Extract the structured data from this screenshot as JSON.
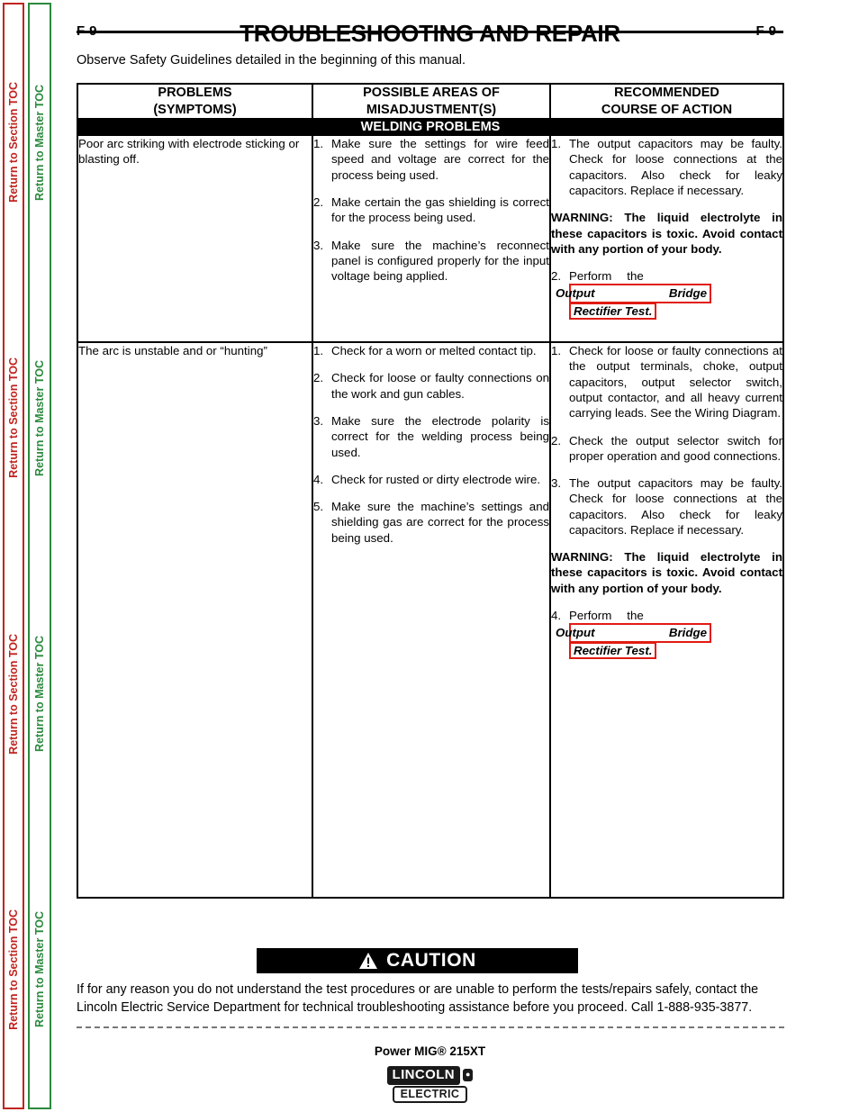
{
  "sidebar": {
    "section_toc_label": "Return to Section TOC",
    "master_toc_label": "Return to Master TOC",
    "section_toc_color": "#C0241F",
    "master_toc_color": "#2B8A3E",
    "repeat_count": 4
  },
  "header": {
    "folio_left": "F-9",
    "folio_right": "F-9",
    "title": "TROUBLESHOOTING AND REPAIR",
    "observe_note": "Observe Safety Guidelines detailed in the beginning of this manual."
  },
  "table": {
    "columns": [
      {
        "line1": "PROBLEMS",
        "line2": "(SYMPTOMS)"
      },
      {
        "line1": "POSSIBLE AREAS OF",
        "line2": "MISADJUSTMENT(S)"
      },
      {
        "line1": "RECOMMENDED",
        "line2": "COURSE OF ACTION"
      }
    ],
    "band_label": "WELDING PROBLEMS",
    "rows": [
      {
        "symptom": "Poor arc striking with electrode sticking or blasting off.",
        "misadjustments": [
          {
            "num": "1.",
            "text": "Make sure the settings for wire feed speed and voltage are correct for the process being used."
          },
          {
            "num": "2.",
            "text": "Make certain the gas shielding is correct for the process being used."
          },
          {
            "num": "3.",
            "text": "Make sure the machine’s reconnect panel is configured properly for the input voltage being applied."
          }
        ],
        "actions": [
          {
            "num": "1.",
            "text": "The output capacitors may be faulty.  Check for loose connections at the capacitors.   Also check for leaky capacitors.  Replace if necessary."
          }
        ],
        "warning": "WARNING: The liquid electrolyte in these capacitors is toxic.  Avoid contact with any portion of your body.",
        "action_link": {
          "num": "2.",
          "lead": "Perform  the",
          "link_line1": "Output   Bridge",
          "link_line2": "Rectifier Test."
        }
      },
      {
        "symptom": "The arc is unstable and or “hunting”",
        "misadjustments": [
          {
            "num": "1.",
            "text": "Check for a worn or melted contact tip."
          },
          {
            "num": "2.",
            "text": "Check for loose or faulty connections on the work and gun cables."
          },
          {
            "num": "3.",
            "text": "Make sure the electrode polarity is correct for the welding process being used."
          },
          {
            "num": "4.",
            "text": "Check for rusted or dirty electrode wire."
          },
          {
            "num": "5.",
            "text": "Make sure the machine’s settings and shielding gas are correct for the process being used."
          }
        ],
        "actions": [
          {
            "num": "1.",
            "text": "Check for loose or faulty connections at the output terminals, choke, output capacitors, output selector switch, output contactor, and all heavy current carrying leads.  See the Wiring Diagram."
          },
          {
            "num": "2.",
            "text": "Check the output selector switch for proper operation and good connections."
          },
          {
            "num": "3.",
            "text": "The output capacitors may be faulty.  Check for loose connections at the capacitors.   Also check for leaky capacitors.  Replace if necessary."
          }
        ],
        "warning": "WARNING: The liquid electrolyte in these capacitors is toxic.  Avoid contact with any portion of your body.",
        "action_link": {
          "num": "4.",
          "lead": "Perform  the",
          "link_line1": "Output   Bridge",
          "link_line2": "Rectifier Test."
        }
      }
    ]
  },
  "caution": {
    "label": "CAUTION",
    "body": "If for any reason you do not understand the test procedures or are unable to perform the tests/repairs safely, contact the Lincoln Electric Service Department for technical troubleshooting assistance before you proceed. Call 1-888-935-3877."
  },
  "footer": {
    "product": "Power MIG® 215XT",
    "logo_primary": "LINCOLN",
    "logo_registered": "●",
    "logo_secondary": "ELECTRIC"
  }
}
